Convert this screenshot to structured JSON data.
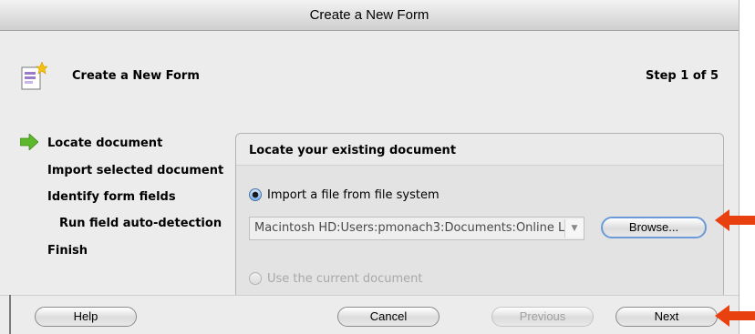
{
  "window": {
    "title": "Create a New Form"
  },
  "header": {
    "title": "Create a New Form",
    "step": "Step 1 of 5",
    "icon": "form-document-star-icon"
  },
  "steps": [
    {
      "label": "Locate document",
      "current": true
    },
    {
      "label": "Import selected document",
      "current": false
    },
    {
      "label": "Identify form fields",
      "current": false
    },
    {
      "label": "Run field auto-detection",
      "current": false
    },
    {
      "label": "Finish",
      "current": false
    }
  ],
  "panel": {
    "title": "Locate your existing document",
    "option_import": "Import a file from file system",
    "path_value": "Macintosh HD:Users:pmonach3:Documents:Online L",
    "browse_label": "Browse...",
    "option_current": "Use the current document"
  },
  "footer": {
    "help_label": "Help",
    "cancel_label": "Cancel",
    "previous_label": "Previous",
    "next_label": "Next"
  },
  "colors": {
    "step_arrow": "#5cb82a",
    "annotation_arrow": "#e8400f",
    "focus_ring": "#6a9bd8"
  }
}
